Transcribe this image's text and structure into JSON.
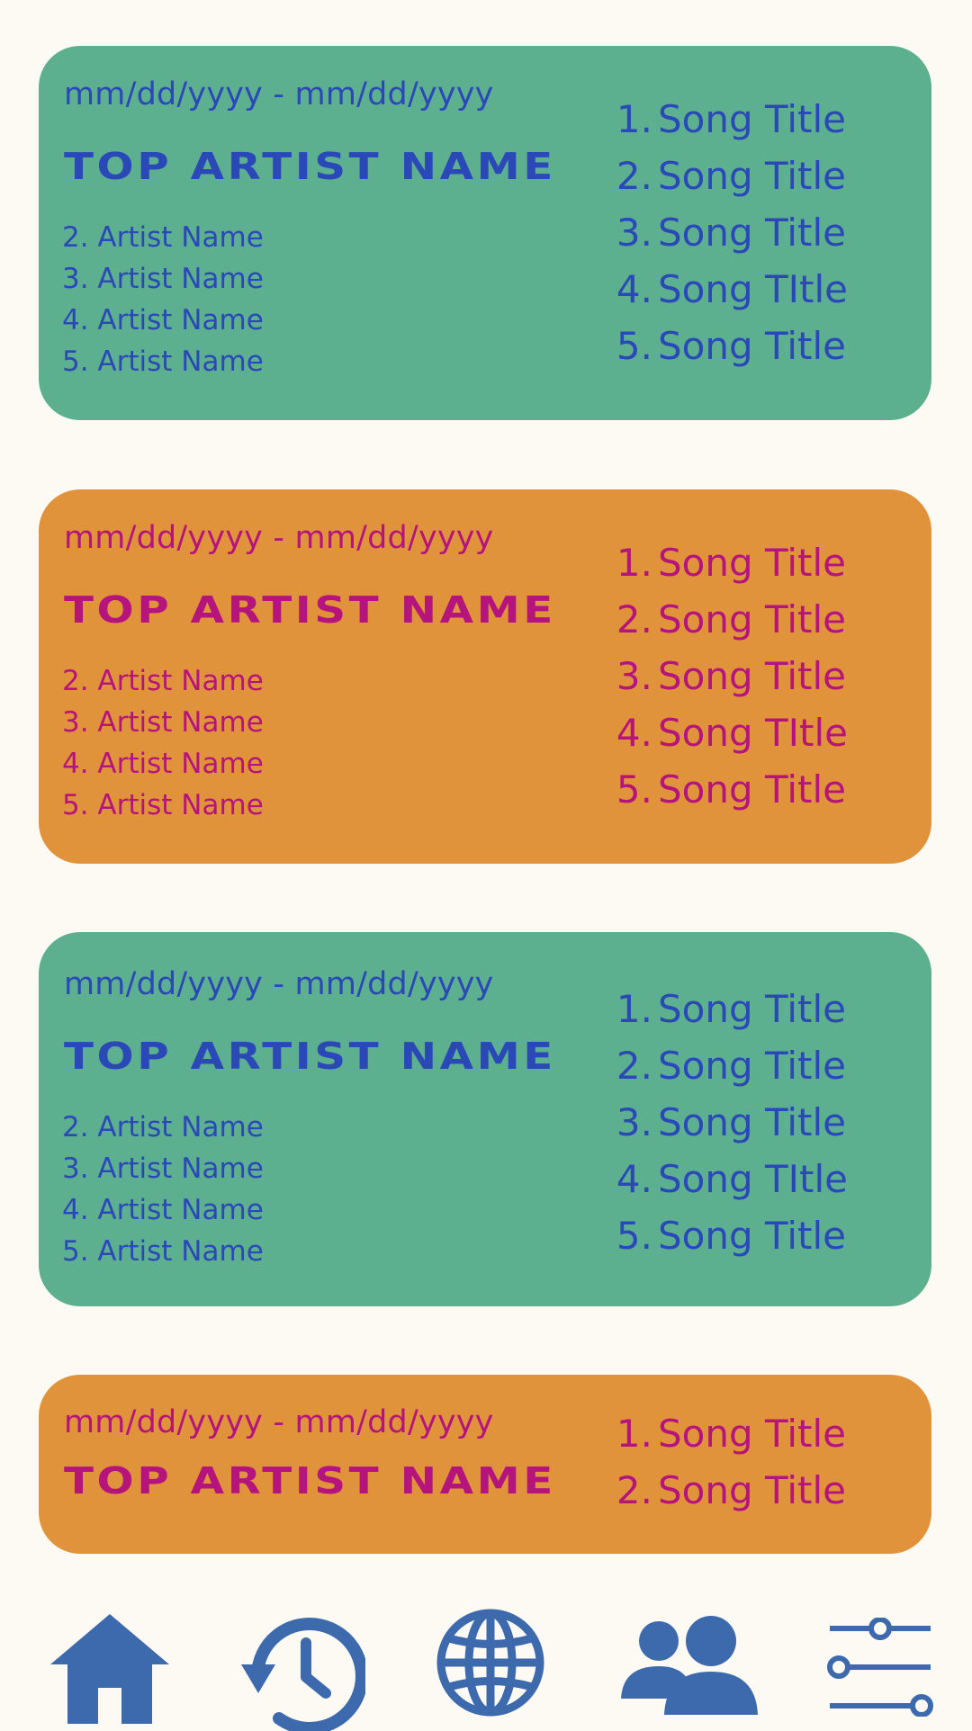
{
  "cards": [
    {
      "theme": "green",
      "date_range": "mm/dd/yyyy - mm/dd/yyyy",
      "top_artist": "TOP ARTIST NAME",
      "artists": [
        "2. Artist Name",
        "3. Artist Name",
        "4. Artist Name",
        "5. Artist Name"
      ],
      "songs": [
        {
          "num": "1.",
          "title": "Song Title"
        },
        {
          "num": "2.",
          "title": "Song Title"
        },
        {
          "num": "3.",
          "title": "Song Title"
        },
        {
          "num": "4.",
          "title": "Song TItle"
        },
        {
          "num": "5.",
          "title": "Song Title"
        }
      ]
    },
    {
      "theme": "orange",
      "date_range": "mm/dd/yyyy - mm/dd/yyyy",
      "top_artist": "TOP ARTIST NAME",
      "artists": [
        "2. Artist Name",
        "3. Artist Name",
        "4. Artist Name",
        "5. Artist Name"
      ],
      "songs": [
        {
          "num": "1.",
          "title": "Song Title"
        },
        {
          "num": "2.",
          "title": "Song Title"
        },
        {
          "num": "3.",
          "title": "Song Title"
        },
        {
          "num": "4.",
          "title": "Song TItle"
        },
        {
          "num": "5.",
          "title": "Song Title"
        }
      ]
    },
    {
      "theme": "green",
      "date_range": "mm/dd/yyyy - mm/dd/yyyy",
      "top_artist": "TOP ARTIST NAME",
      "artists": [
        "2. Artist Name",
        "3. Artist Name",
        "4. Artist Name",
        "5. Artist Name"
      ],
      "songs": [
        {
          "num": "1.",
          "title": "Song Title"
        },
        {
          "num": "2.",
          "title": "Song Title"
        },
        {
          "num": "3.",
          "title": "Song Title"
        },
        {
          "num": "4.",
          "title": "Song TItle"
        },
        {
          "num": "5.",
          "title": "Song Title"
        }
      ]
    },
    {
      "theme": "orange",
      "date_range": "mm/dd/yyyy - mm/dd/yyyy",
      "top_artist": "TOP ARTIST NAME",
      "artists": [],
      "songs": [
        {
          "num": "1.",
          "title": "Song Title"
        },
        {
          "num": "2.",
          "title": "Song Title"
        }
      ]
    }
  ],
  "nav": [
    {
      "icon": "home-icon"
    },
    {
      "icon": "history-icon"
    },
    {
      "icon": "globe-icon"
    },
    {
      "icon": "friends-icon"
    },
    {
      "icon": "settings-sliders-icon"
    }
  ],
  "colors": {
    "background": "#FDFAF3",
    "card_green": "#5DB08F",
    "card_orange": "#E1933B",
    "text_blue": "#2A48B8",
    "text_magenta": "#B5147C",
    "nav_icon": "#3D6AAC"
  }
}
